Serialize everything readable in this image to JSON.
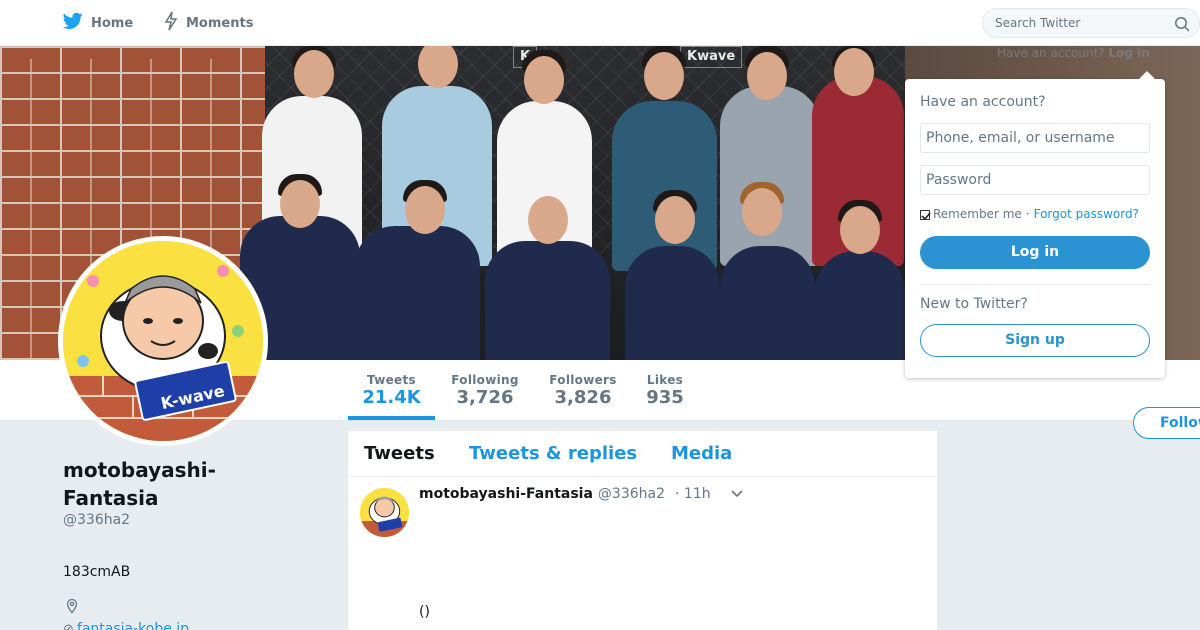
{
  "nav": {
    "home_label": "Home",
    "moments_label": "Moments",
    "home_icon": "twitter-bird-icon",
    "moments_icon": "lightning-icon"
  },
  "search": {
    "placeholder": "Search Twitter",
    "icon": "search-icon"
  },
  "banner": {
    "sign_left": "K",
    "sign_right": "Kwave"
  },
  "login_hint": {
    "text": "Have an account?",
    "link": "Log in"
  },
  "login_popup": {
    "heading": "Have an account?",
    "username_placeholder": "Phone, email, or username",
    "password_placeholder": "Password",
    "remember_label": "Remember me",
    "separator": "·",
    "forgot_label": "Forgot password?",
    "login_button": "Log in",
    "new_heading": "New to Twitter?",
    "signup_button": "Sign up"
  },
  "stats": [
    {
      "label": "Tweets",
      "value": "21.4K"
    },
    {
      "label": "Following",
      "value": "3,726"
    },
    {
      "label": "Followers",
      "value": "3,826"
    },
    {
      "label": "Likes",
      "value": "935"
    }
  ],
  "follow_button": "Follow",
  "profile": {
    "name": "motobayashi-Fantasia",
    "handle": "@336ha2",
    "bio": "183cmAB",
    "link": "fantasia-kobe.jp",
    "avatar_badge": "K-wave"
  },
  "timeline": {
    "tabs": [
      "Tweets",
      "Tweets & replies",
      "Media"
    ],
    "active_tab": "Tweets",
    "tweet": {
      "name": "motobayashi-Fantasia",
      "handle": "@336ha2",
      "separator": "·",
      "time": "11h",
      "text": "()"
    }
  },
  "colors": {
    "accent": "#1b95e0",
    "button_blue": "#2b93d1",
    "background": "#e6ecf0"
  }
}
